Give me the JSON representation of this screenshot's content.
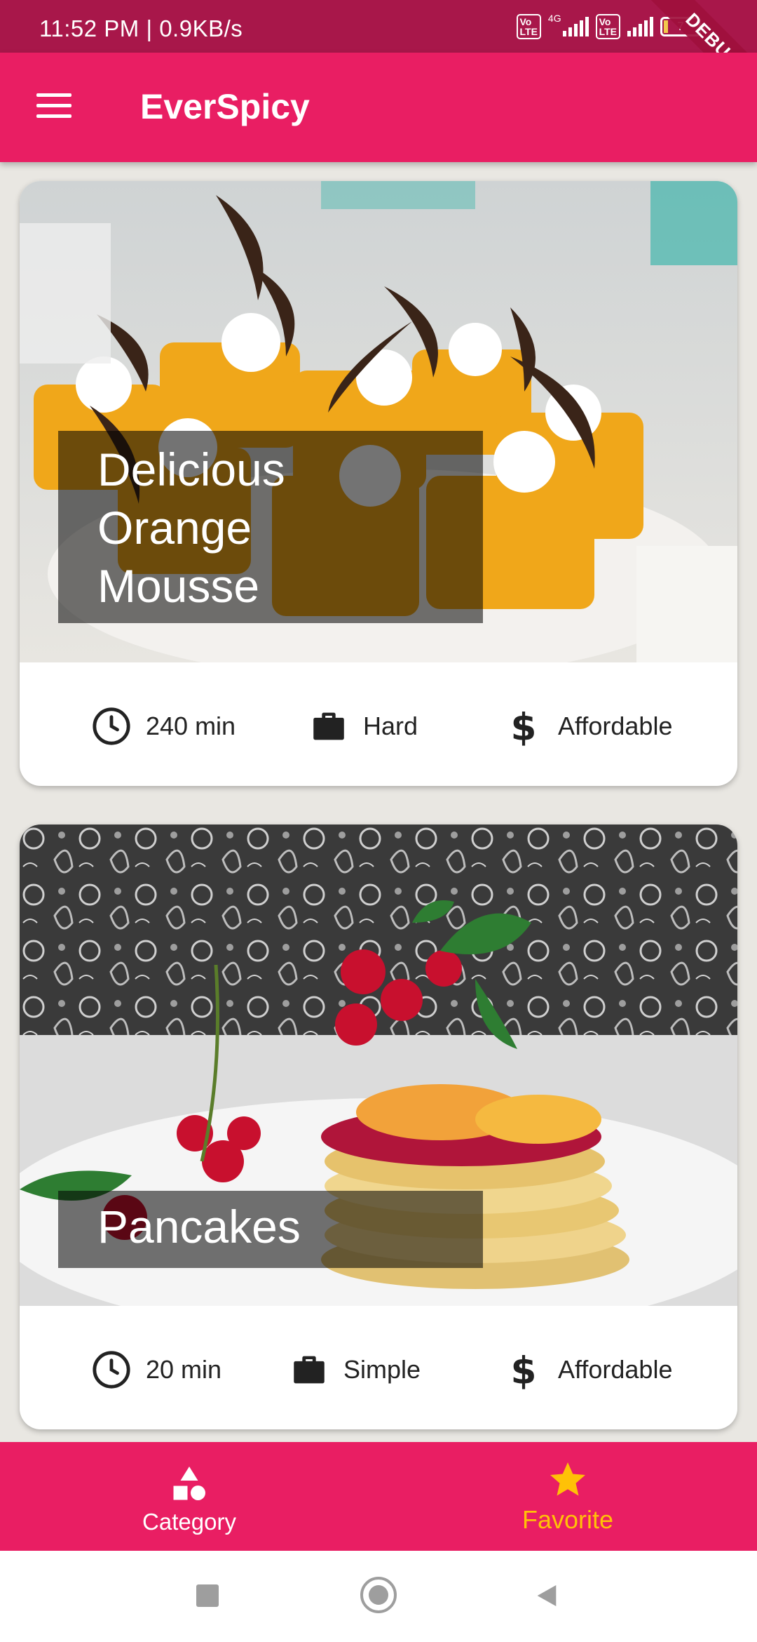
{
  "status_bar": {
    "time_speed": "11:52 PM | 0.9KB/s",
    "volte_label": "Vo LTE",
    "network_label": "4G",
    "battery_level": "7",
    "debug_banner": "DEBUG"
  },
  "app_bar": {
    "title": "EverSpicy",
    "menu_icon": "hamburger-menu-icon"
  },
  "meals": [
    {
      "title_lines": [
        "Delicious",
        "Orange",
        "Mousse"
      ],
      "duration": "240 min",
      "complexity": "Hard",
      "affordability": "Affordable"
    },
    {
      "title_lines": [
        "Pancakes"
      ],
      "duration": "20 min",
      "complexity": "Simple",
      "affordability": "Affordable"
    }
  ],
  "bottom_nav": {
    "items": [
      {
        "label": "Category",
        "icon": "shapes-icon",
        "selected": false
      },
      {
        "label": "Favorite",
        "icon": "star-icon",
        "selected": true
      }
    ]
  },
  "colors": {
    "primary": "#e91e63",
    "status_bar": "#a8174a",
    "accent": "#ffc107",
    "background": "#e9e7e2"
  }
}
